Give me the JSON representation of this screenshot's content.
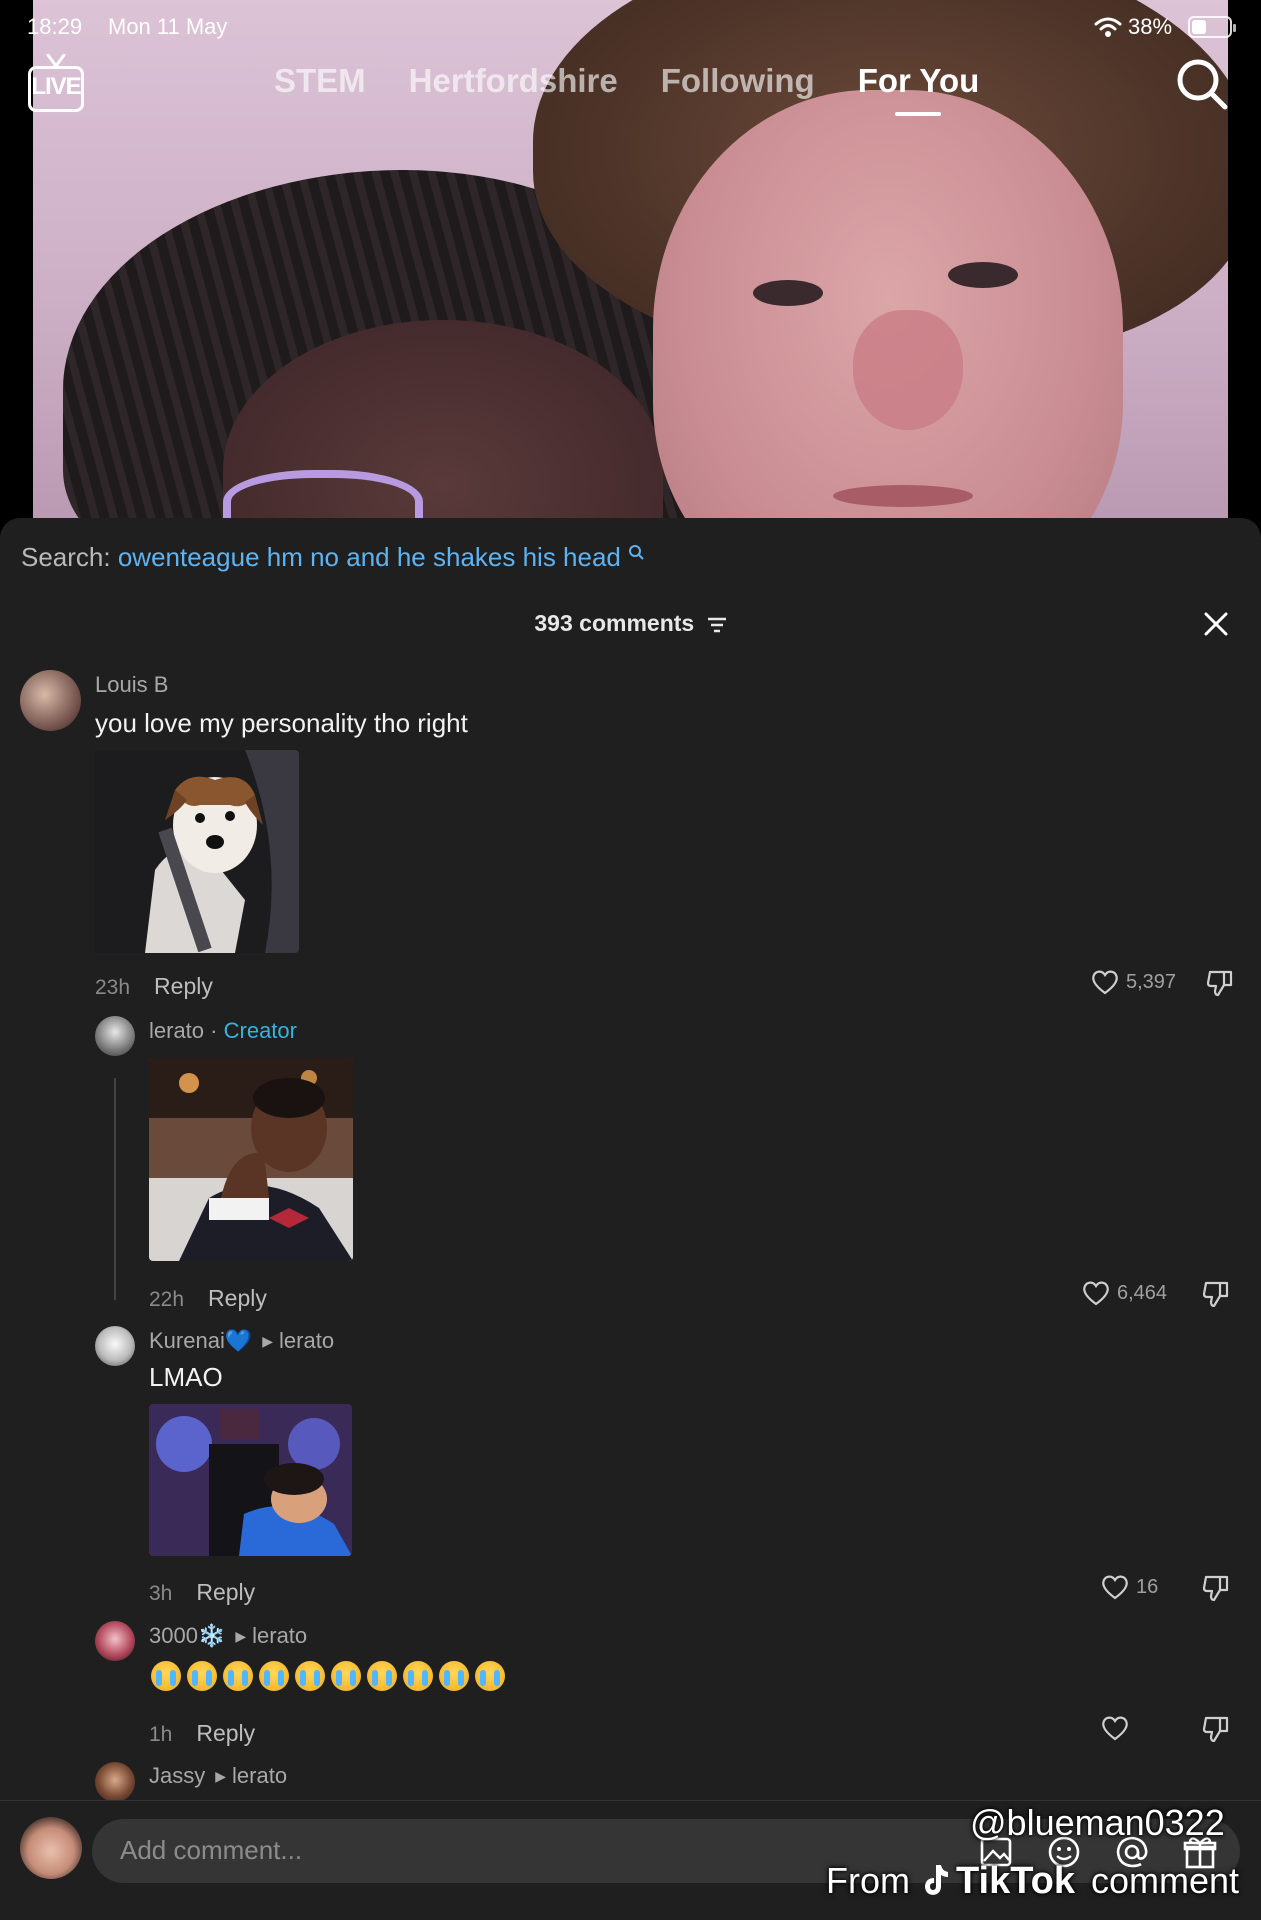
{
  "status_bar": {
    "time": "18:29",
    "date": "Mon 11 May",
    "battery_percent": "38%",
    "battery_level": 0.38
  },
  "top_nav": {
    "live_label": "LIVE",
    "tabs": [
      {
        "label": "STEM",
        "active": false
      },
      {
        "label": "Hertfordshire",
        "active": false
      },
      {
        "label": "Following",
        "active": false
      },
      {
        "label": "For You",
        "active": true
      }
    ]
  },
  "comments_panel": {
    "search_prefix": "Search:",
    "search_query": "owenteague hm no and he shakes his head",
    "count_label": "393 comments",
    "comments": [
      {
        "username": "Louis B",
        "text": "you love my personality tho right",
        "time": "23h",
        "reply_label": "Reply",
        "likes": "5,397"
      },
      {
        "username": "lerato",
        "tag": "Creator",
        "separator": "·",
        "time": "22h",
        "reply_label": "Reply",
        "likes": "6,464"
      },
      {
        "username": "Kurenai💙",
        "reply_to": "lerato",
        "text": "LMAO",
        "time": "3h",
        "reply_label": "Reply",
        "likes": "16"
      },
      {
        "username": "3000❄️",
        "reply_to": "lerato",
        "time": "1h",
        "reply_label": "Reply",
        "likes": "",
        "emoji_count": 10,
        "emoji": "loudly-crying-face"
      },
      {
        "username": "Jassy",
        "reply_to": "lerato"
      }
    ]
  },
  "input_bar": {
    "placeholder": "Add comment..."
  },
  "watermark": {
    "handle": "@blueman0322",
    "from_label": "From",
    "brand": "TikTok",
    "suffix": "comment"
  },
  "colors": {
    "sheet_background": "#1f1f1f",
    "search_link": "#5eb3f0",
    "creator_tag": "#39b3dd"
  }
}
